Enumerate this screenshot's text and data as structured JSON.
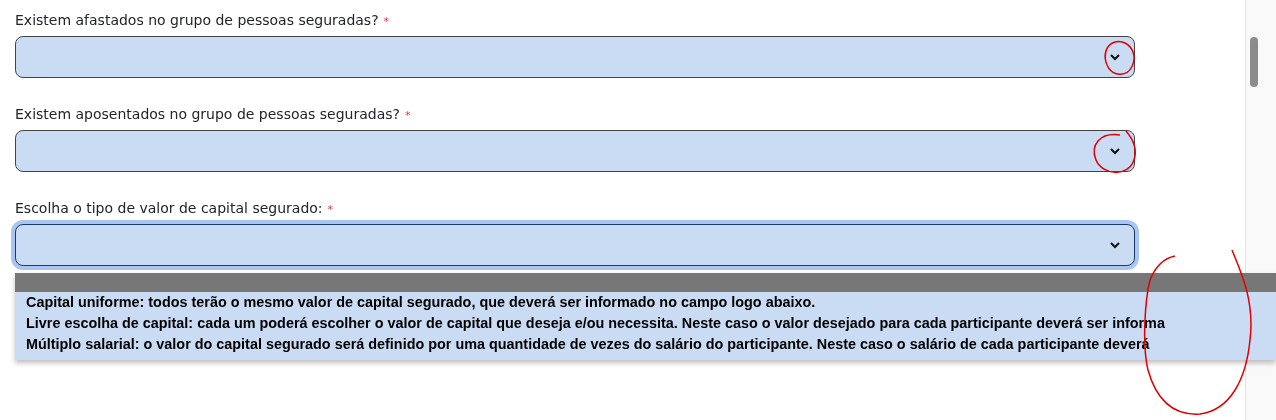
{
  "fields": [
    {
      "label": "Existem afastados no grupo de pessoas seguradas?",
      "required_mark": "*",
      "focused": false
    },
    {
      "label": "Existem aposentados no grupo de pessoas seguradas?",
      "required_mark": "*",
      "focused": false
    },
    {
      "label": "Escolha o tipo de valor de capital segurado:",
      "required_mark": "*",
      "focused": true,
      "blank_option_highlighted": true,
      "options": [
        {
          "label": "Capital uniforme: todos terão o mesmo valor de capital segurado, que deverá ser informado no campo logo abaixo.",
          "selected": false
        },
        {
          "label": "Livre escolha de capital: cada um poderá escolher o valor de capital que deseja e/ou necessita. Neste caso o valor desejado para cada participante deverá ser informa",
          "selected": false
        },
        {
          "label": "Múltiplo salarial: o valor do capital segurado será definido por uma quantidade de vezes do salário do participante. Neste caso o salário de cada participante deverá",
          "selected": false
        }
      ]
    }
  ]
}
